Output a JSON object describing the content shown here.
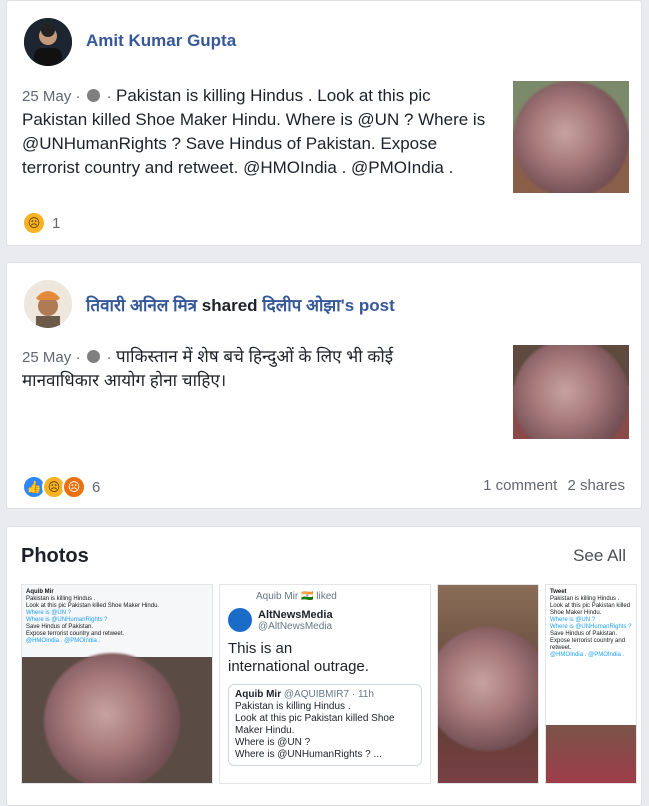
{
  "post1": {
    "author": "Amit Kumar Gupta",
    "date": "25 May",
    "sep": "·",
    "text": "Pakistan is killing Hindus . Look at this pic Pakistan killed Shoe Maker Hindu. Where is @UN ? Where is @UNHumanRights ? Save Hindus of Pakistan. Expose terrorist country and retweet. @HMOIndia . @PMOIndia .",
    "reaction_count": "1",
    "reaction_icons": [
      "sad-icon"
    ]
  },
  "post2": {
    "author": "तिवारी अनिल मित्र",
    "shared_word": "shared",
    "shared_from": "दिलीप ओझा's post",
    "date": "25 May",
    "sep": "·",
    "text": "पाकिस्तान में शेष बचे हिन्दुओं के लिए भी कोई मानवाधिकार आयोग होना चाहिए।",
    "reaction_count": "6",
    "reaction_icons": [
      "like-icon",
      "sad-icon",
      "angry-icon"
    ],
    "comments": "1 comment",
    "shares": "2 shares"
  },
  "photos": {
    "title": "Photos",
    "see_all": "See All",
    "photo2": {
      "liked_line": "Aquib Mir 🇮🇳 liked",
      "account_name": "AltNewsMedia",
      "account_handle": "@AltNewsMedia",
      "tweet": "This is an international outrage.",
      "quoted_author": "Aquib Mir",
      "quoted_handle": "@AQUIBMIR7 · 11h",
      "quoted_text_1": "Pakistan is killing Hindus .",
      "quoted_text_2": "Look at this pic Pakistan killed Shoe Maker Hindu.",
      "quoted_text_3": "Where is @UN ?",
      "quoted_text_4": "Where is @UNHumanRights ? ..."
    },
    "photo1": {
      "header": "Aquib Mir",
      "line1": "Pakistan is killing Hindus .",
      "line2": "Look at this pic Pakistan killed Shoe Maker Hindu.",
      "line3": "Where is @UN ?",
      "line4": "Where is @UNHumanRights ?",
      "line5": "Save Hindus of Pakistan.",
      "line6": "Expose terrorist country and retweet.",
      "line7": "@HMOIndia . @PMOIndia ."
    },
    "photo4": {
      "header": "Tweet",
      "line1": "Pakistan is killing Hindus .",
      "line2": "Look at this pic Pakistan killed Shoe Maker Hindu.",
      "line3": "Where is @UN ?",
      "line4": "Where is @UNHumanRights ?",
      "line5": "Save Hindus of Pakistan.",
      "line6": "Expose terrorist country and retweet.",
      "line7": "@HMOIndia . @PMOIndia ."
    }
  },
  "colors": {
    "link_blue": "#365899",
    "background": "#e9ebee",
    "like_blue": "#2d88ff",
    "sad_yellow": "#f7b125",
    "angry_orange": "#e9710f"
  }
}
